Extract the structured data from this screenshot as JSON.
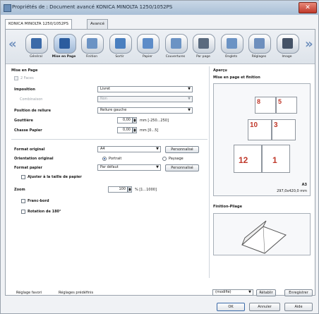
{
  "window": {
    "title": "Propriétés de : Document avancé KONICA MINOLTA 1250/1052PS",
    "close_glyph": "✕"
  },
  "tabs": [
    {
      "label": "KONICA MINOLTA 1250/1052PS"
    },
    {
      "label": "Avancé"
    }
  ],
  "ribbon": {
    "items": [
      {
        "label": "Général",
        "icon": "general-icon",
        "color": "#3b6aa8"
      },
      {
        "label": "Mise en Page",
        "icon": "layout-icon",
        "color": "#2b5c9e"
      },
      {
        "label": "Finition",
        "icon": "finishing-icon",
        "color": "#6b93c4"
      },
      {
        "label": "Sortir",
        "icon": "output-icon",
        "color": "#4a7fbf"
      },
      {
        "label": "Papier",
        "icon": "paper-icon",
        "color": "#5d8cc8"
      },
      {
        "label": "Couvertures",
        "icon": "covers-icon",
        "color": "#6b93c4"
      },
      {
        "label": "Par page",
        "icon": "per-page-icon",
        "color": "#5a6a7e"
      },
      {
        "label": "Onglets",
        "icon": "tabs-icon",
        "color": "#6b93c4"
      },
      {
        "label": "Réglages",
        "icon": "settings-icon",
        "color": "#6e8fbd"
      },
      {
        "label": "Image",
        "icon": "image-icon",
        "color": "#445266"
      }
    ],
    "prev_glyph": "«",
    "next_glyph": "»"
  },
  "layout": {
    "section": "Mise en Page",
    "two_sides_label": "2 Faces",
    "impose_label": "Imposition",
    "impose_value": "Livret",
    "combine_label": "Combinaison",
    "combine_value": "Non",
    "binding_label": "Position de reliure",
    "binding_value": "Reliure gauche",
    "gutter_label": "Gouttière",
    "gutter_value": "0,00",
    "gutter_unit": "mm [-250...250]",
    "shift_label": "Chasse Papier",
    "shift_value": "0,00",
    "shift_unit": "mm [0...5]"
  },
  "format": {
    "original_label": "Format original",
    "original_value": "A4",
    "custom1": "Personnalisé",
    "orientation_label": "Orientation original",
    "portrait": "Portrait",
    "landscape": "Paysage",
    "paper_label": "Format papier",
    "paper_value": "Par défaut",
    "custom2": "Personnalisé",
    "fit_label": "Ajuster à la taille de papier",
    "zoom_label": "Zoom",
    "zoom_value": "100",
    "zoom_unit": "% [1...1000]",
    "borderless_label": "Franc-bord",
    "rotate_label": "Rotation de 180°"
  },
  "preview": {
    "title": "Aperçu",
    "subtitle": "Mise en page et finition",
    "numbers": [
      "8",
      "5",
      "10",
      "3",
      "12",
      "1"
    ],
    "size_code": "A3",
    "size_value": "297,0x420,0 mm",
    "stamp_title": "Finition-Pliage"
  },
  "bottom": {
    "favorites": "Réglage favori",
    "presets": "Réglages prédéfinis",
    "default_value": "(modifié)",
    "restore": "Rétablir",
    "save": "Enregistrer",
    "ok": "OK",
    "cancel": "Annuler",
    "help": "Aide"
  }
}
